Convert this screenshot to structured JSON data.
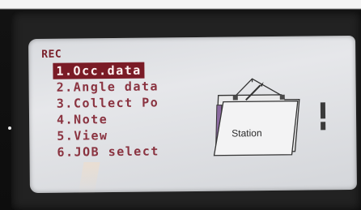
{
  "screen": {
    "title": "REC",
    "menu": [
      {
        "label": "1.Occ.data",
        "selected": true
      },
      {
        "label": "2.Angle data",
        "selected": false
      },
      {
        "label": "3.Collect Po",
        "selected": false
      },
      {
        "label": "4.Note",
        "selected": false
      },
      {
        "label": "5.View",
        "selected": false
      },
      {
        "label": "6.JOB select",
        "selected": false
      }
    ],
    "illustration_label": "Station"
  },
  "colors": {
    "menu_text": "#8a3340",
    "selection_bg": "#7a1b26",
    "screen_bg": "#e2e3e6"
  },
  "icons": [
    "folder-icon",
    "pen-icon"
  ]
}
